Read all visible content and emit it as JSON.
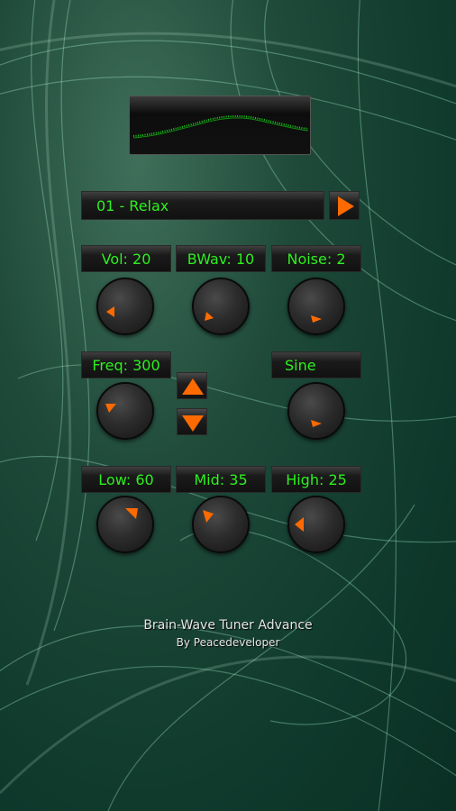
{
  "app": {
    "title": "Brain-Wave Tuner Advance",
    "subtitle": "By Peacedeveloper"
  },
  "preset": {
    "label": "01 - Relax"
  },
  "controls": {
    "vol": {
      "label": "Vol: 20"
    },
    "bwav": {
      "label": "BWav: 10"
    },
    "noise": {
      "label": "Noise: 2"
    },
    "freq": {
      "label": "Freq: 300"
    },
    "wave": {
      "label": "Sine"
    },
    "low": {
      "label": "Low: 60"
    },
    "mid": {
      "label": "Mid: 35"
    },
    "high": {
      "label": "High: 25"
    }
  },
  "icons": {
    "play": "play-icon",
    "up": "arrow-up-icon",
    "down": "arrow-down-icon",
    "knob_pointer": "triangle-pointer-icon"
  },
  "colors": {
    "label_text": "#2df01f",
    "accent_orange": "#ff6a00",
    "waveform": "#1bd11b"
  }
}
